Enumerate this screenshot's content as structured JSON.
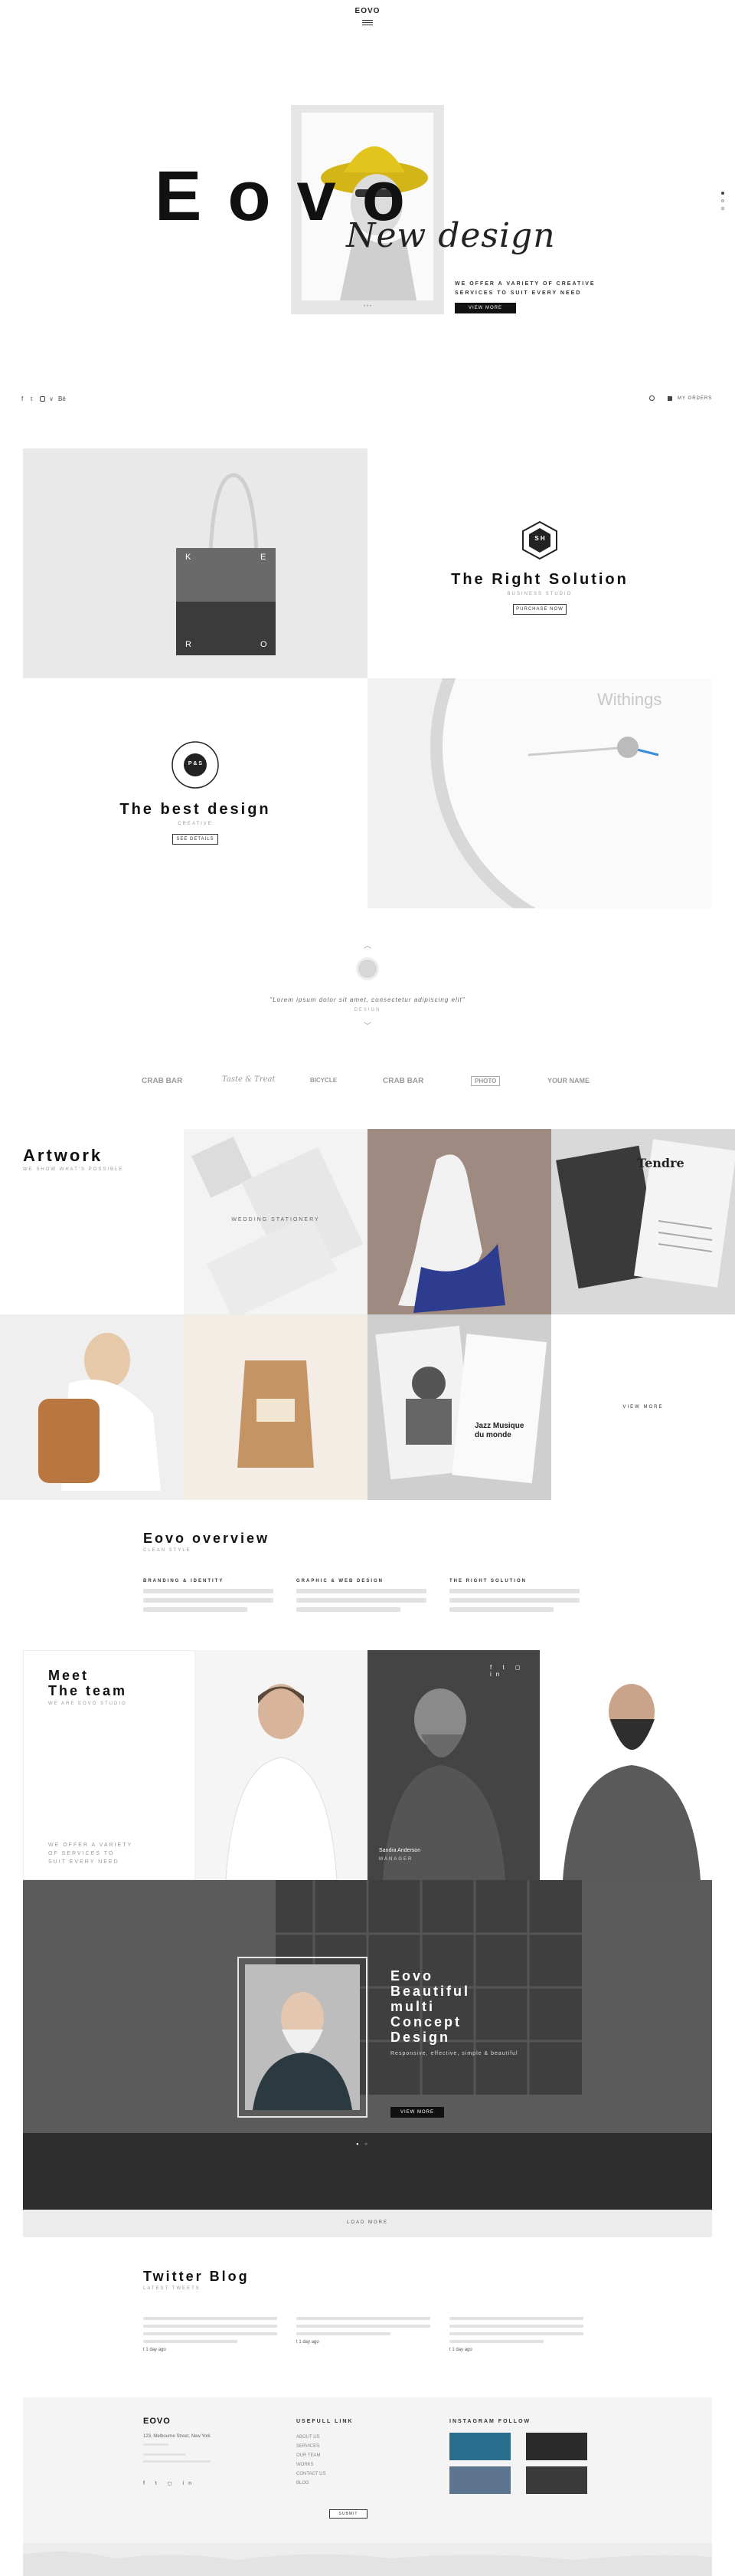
{
  "header": {
    "logo": "EOVO",
    "menu_icon": "hamburger-icon"
  },
  "hero": {
    "title": "Eovo",
    "script": "New design",
    "tagline_line1": "WE OFFER A VARIETY OF CREATIVE",
    "tagline_line2": "SERVICES TO SUIT EVERY NEED",
    "button": "VIEW MORE",
    "slide_dots": "• • •"
  },
  "social_bar": {
    "icons": [
      "facebook-icon",
      "twitter-icon",
      "instagram-icon",
      "vimeo-icon",
      "behance-icon"
    ],
    "cart": "MY ORDERS"
  },
  "features": [
    {
      "title": "The Right Solution",
      "subtitle": "BUSINESS STUDIO",
      "button": "PURCHASE NOW",
      "badge": "S H"
    },
    {
      "title": "The best design",
      "subtitle": "CREATIVE",
      "button": "SEE DETAILS",
      "badge": "P & S"
    }
  ],
  "bag_letters": [
    "K",
    "E",
    "R",
    "O"
  ],
  "testimonial": {
    "quote": "\"Lorem ipsum dolor sit amet, consectetur adipiscing elit\"",
    "author": "DESIGN"
  },
  "brand_logos": [
    "CRAB BAR",
    "Taste & Treat",
    "BICYCLE",
    "CRAB BAR",
    "PHOTO",
    "YOUR NAME"
  ],
  "artwork": {
    "title": "Artwork",
    "subtitle": "WE SHOW WHAT'S POSSIBLE",
    "overlay_text": "WEDDING STATIONERY",
    "poster_title": "Tendre",
    "magazine_text": "Jazz Musique du monde",
    "view_more": "VIEW MORE"
  },
  "overview": {
    "title": "Eovo overview",
    "subtitle": "CLEAN STYLE",
    "columns": [
      {
        "heading": "BRANDING & IDENTITY"
      },
      {
        "heading": "GRAPHIC & WEB DESIGN"
      },
      {
        "heading": "THE RIGHT SOLUTION"
      }
    ]
  },
  "team": {
    "title_line1": "Meet",
    "title_line2": "The team",
    "subtitle": "WE ARE EOVO STUDIO",
    "desc_line1": "WE OFFER A VARIETY",
    "desc_line2": "OF SERVICES TO",
    "desc_line3": "SUIT EVERY NEED",
    "member_name": "Sandra Anderson",
    "member_role": "MANAGER"
  },
  "promo": {
    "line1": "Eovo",
    "line2": "Beautiful",
    "line3": "multi",
    "line4": "Concept",
    "line5": "Design",
    "sub": "Responsive, effective, simple & beautiful",
    "button": "VIEW MORE",
    "load_more": "LOAD MORE"
  },
  "twitter": {
    "title": "Twitter Blog",
    "subtitle": "LATEST TWEETS",
    "time": "1 day ago"
  },
  "footer": {
    "logo": "EOVO",
    "address": "123, Melbourne Street, New York",
    "col2_title": "USEFULL LINK",
    "col2_links": [
      "ABOUT US",
      "SERVICES",
      "OUR TEAM",
      "WORKS",
      "CONTACT US",
      "BLOG"
    ],
    "col3_title": "INSTAGRAM FOLLOW",
    "submit": "SUBMIT"
  }
}
